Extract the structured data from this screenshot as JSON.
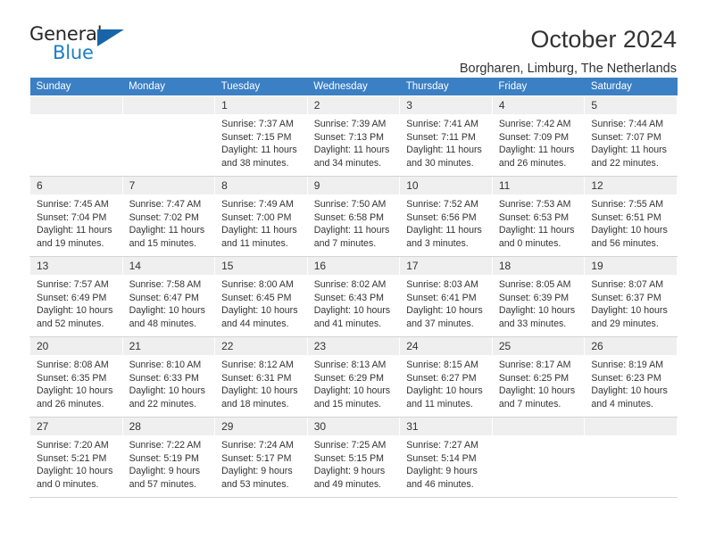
{
  "logo": {
    "word_top": "General",
    "word_bottom": "Blue",
    "triangle_color": "#1765a8",
    "blue_color": "#1d7fc3"
  },
  "header": {
    "title": "October 2024",
    "location": "Borgharen, Limburg, The Netherlands"
  },
  "colors": {
    "header_row_background": "#3b7fc4",
    "header_row_text": "#ffffff",
    "day_number_background": "#efefef",
    "cell_text": "#333333",
    "grid_line": "#d4d4d4"
  },
  "weekdays": [
    "Sunday",
    "Monday",
    "Tuesday",
    "Wednesday",
    "Thursday",
    "Friday",
    "Saturday"
  ],
  "labels": {
    "sunrise_prefix": "Sunrise:",
    "sunset_prefix": "Sunset:",
    "daylight_prefix": "Daylight:"
  },
  "weeks": [
    [
      {
        "day": "",
        "sunrise": "",
        "sunset": "",
        "daylight": "",
        "empty": true
      },
      {
        "day": "",
        "sunrise": "",
        "sunset": "",
        "daylight": "",
        "empty": true
      },
      {
        "day": "1",
        "sunrise": "Sunrise: 7:37 AM",
        "sunset": "Sunset: 7:15 PM",
        "daylight": "Daylight: 11 hours and 38 minutes."
      },
      {
        "day": "2",
        "sunrise": "Sunrise: 7:39 AM",
        "sunset": "Sunset: 7:13 PM",
        "daylight": "Daylight: 11 hours and 34 minutes."
      },
      {
        "day": "3",
        "sunrise": "Sunrise: 7:41 AM",
        "sunset": "Sunset: 7:11 PM",
        "daylight": "Daylight: 11 hours and 30 minutes."
      },
      {
        "day": "4",
        "sunrise": "Sunrise: 7:42 AM",
        "sunset": "Sunset: 7:09 PM",
        "daylight": "Daylight: 11 hours and 26 minutes."
      },
      {
        "day": "5",
        "sunrise": "Sunrise: 7:44 AM",
        "sunset": "Sunset: 7:07 PM",
        "daylight": "Daylight: 11 hours and 22 minutes."
      }
    ],
    [
      {
        "day": "6",
        "sunrise": "Sunrise: 7:45 AM",
        "sunset": "Sunset: 7:04 PM",
        "daylight": "Daylight: 11 hours and 19 minutes."
      },
      {
        "day": "7",
        "sunrise": "Sunrise: 7:47 AM",
        "sunset": "Sunset: 7:02 PM",
        "daylight": "Daylight: 11 hours and 15 minutes."
      },
      {
        "day": "8",
        "sunrise": "Sunrise: 7:49 AM",
        "sunset": "Sunset: 7:00 PM",
        "daylight": "Daylight: 11 hours and 11 minutes."
      },
      {
        "day": "9",
        "sunrise": "Sunrise: 7:50 AM",
        "sunset": "Sunset: 6:58 PM",
        "daylight": "Daylight: 11 hours and 7 minutes."
      },
      {
        "day": "10",
        "sunrise": "Sunrise: 7:52 AM",
        "sunset": "Sunset: 6:56 PM",
        "daylight": "Daylight: 11 hours and 3 minutes."
      },
      {
        "day": "11",
        "sunrise": "Sunrise: 7:53 AM",
        "sunset": "Sunset: 6:53 PM",
        "daylight": "Daylight: 11 hours and 0 minutes."
      },
      {
        "day": "12",
        "sunrise": "Sunrise: 7:55 AM",
        "sunset": "Sunset: 6:51 PM",
        "daylight": "Daylight: 10 hours and 56 minutes."
      }
    ],
    [
      {
        "day": "13",
        "sunrise": "Sunrise: 7:57 AM",
        "sunset": "Sunset: 6:49 PM",
        "daylight": "Daylight: 10 hours and 52 minutes."
      },
      {
        "day": "14",
        "sunrise": "Sunrise: 7:58 AM",
        "sunset": "Sunset: 6:47 PM",
        "daylight": "Daylight: 10 hours and 48 minutes."
      },
      {
        "day": "15",
        "sunrise": "Sunrise: 8:00 AM",
        "sunset": "Sunset: 6:45 PM",
        "daylight": "Daylight: 10 hours and 44 minutes."
      },
      {
        "day": "16",
        "sunrise": "Sunrise: 8:02 AM",
        "sunset": "Sunset: 6:43 PM",
        "daylight": "Daylight: 10 hours and 41 minutes."
      },
      {
        "day": "17",
        "sunrise": "Sunrise: 8:03 AM",
        "sunset": "Sunset: 6:41 PM",
        "daylight": "Daylight: 10 hours and 37 minutes."
      },
      {
        "day": "18",
        "sunrise": "Sunrise: 8:05 AM",
        "sunset": "Sunset: 6:39 PM",
        "daylight": "Daylight: 10 hours and 33 minutes."
      },
      {
        "day": "19",
        "sunrise": "Sunrise: 8:07 AM",
        "sunset": "Sunset: 6:37 PM",
        "daylight": "Daylight: 10 hours and 29 minutes."
      }
    ],
    [
      {
        "day": "20",
        "sunrise": "Sunrise: 8:08 AM",
        "sunset": "Sunset: 6:35 PM",
        "daylight": "Daylight: 10 hours and 26 minutes."
      },
      {
        "day": "21",
        "sunrise": "Sunrise: 8:10 AM",
        "sunset": "Sunset: 6:33 PM",
        "daylight": "Daylight: 10 hours and 22 minutes."
      },
      {
        "day": "22",
        "sunrise": "Sunrise: 8:12 AM",
        "sunset": "Sunset: 6:31 PM",
        "daylight": "Daylight: 10 hours and 18 minutes."
      },
      {
        "day": "23",
        "sunrise": "Sunrise: 8:13 AM",
        "sunset": "Sunset: 6:29 PM",
        "daylight": "Daylight: 10 hours and 15 minutes."
      },
      {
        "day": "24",
        "sunrise": "Sunrise: 8:15 AM",
        "sunset": "Sunset: 6:27 PM",
        "daylight": "Daylight: 10 hours and 11 minutes."
      },
      {
        "day": "25",
        "sunrise": "Sunrise: 8:17 AM",
        "sunset": "Sunset: 6:25 PM",
        "daylight": "Daylight: 10 hours and 7 minutes."
      },
      {
        "day": "26",
        "sunrise": "Sunrise: 8:19 AM",
        "sunset": "Sunset: 6:23 PM",
        "daylight": "Daylight: 10 hours and 4 minutes."
      }
    ],
    [
      {
        "day": "27",
        "sunrise": "Sunrise: 7:20 AM",
        "sunset": "Sunset: 5:21 PM",
        "daylight": "Daylight: 10 hours and 0 minutes."
      },
      {
        "day": "28",
        "sunrise": "Sunrise: 7:22 AM",
        "sunset": "Sunset: 5:19 PM",
        "daylight": "Daylight: 9 hours and 57 minutes."
      },
      {
        "day": "29",
        "sunrise": "Sunrise: 7:24 AM",
        "sunset": "Sunset: 5:17 PM",
        "daylight": "Daylight: 9 hours and 53 minutes."
      },
      {
        "day": "30",
        "sunrise": "Sunrise: 7:25 AM",
        "sunset": "Sunset: 5:15 PM",
        "daylight": "Daylight: 9 hours and 49 minutes."
      },
      {
        "day": "31",
        "sunrise": "Sunrise: 7:27 AM",
        "sunset": "Sunset: 5:14 PM",
        "daylight": "Daylight: 9 hours and 46 minutes."
      },
      {
        "day": "",
        "sunrise": "",
        "sunset": "",
        "daylight": "",
        "empty": true
      },
      {
        "day": "",
        "sunrise": "",
        "sunset": "",
        "daylight": "",
        "empty": true
      }
    ]
  ]
}
